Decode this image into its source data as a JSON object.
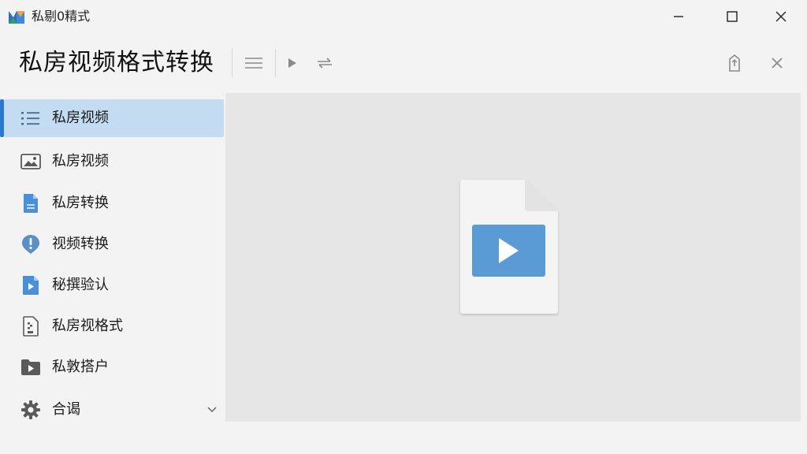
{
  "window": {
    "title": "私剔0精式",
    "app_icon": "app-logo-icon",
    "controls": [
      "minimize-icon",
      "maximize-icon",
      "close-icon"
    ]
  },
  "header": {
    "title": "私房视频格式转换",
    "toolbar_icons": [
      "list-icon",
      "play-icon",
      "convert-arrows-icon"
    ],
    "right_icons": [
      "export-icon",
      "close-icon"
    ]
  },
  "sidebar": {
    "items": [
      {
        "label": "私房视频",
        "icon": "list-icon",
        "active": true
      },
      {
        "label": "私房视频",
        "icon": "image-icon",
        "active": false
      },
      {
        "label": "私房转换",
        "icon": "document-icon",
        "active": false
      },
      {
        "label": "视频转换",
        "icon": "alert-icon",
        "active": false
      },
      {
        "label": "秘撰验认",
        "icon": "video-file-icon",
        "active": false
      },
      {
        "label": "私房视格式",
        "icon": "archive-file-icon",
        "active": false
      },
      {
        "label": "私敦搭户",
        "icon": "video-folder-icon",
        "active": false
      },
      {
        "label": "合谒",
        "icon": "gear-icon",
        "active": false,
        "expandable": true
      }
    ]
  },
  "main": {
    "placeholder_icon": "video-file-icon"
  },
  "colors": {
    "accent": "#2b78d0",
    "active_bg": "#c3dcf2",
    "content_bg": "#e6e6e6",
    "icon_blue": "#4a90d9"
  }
}
